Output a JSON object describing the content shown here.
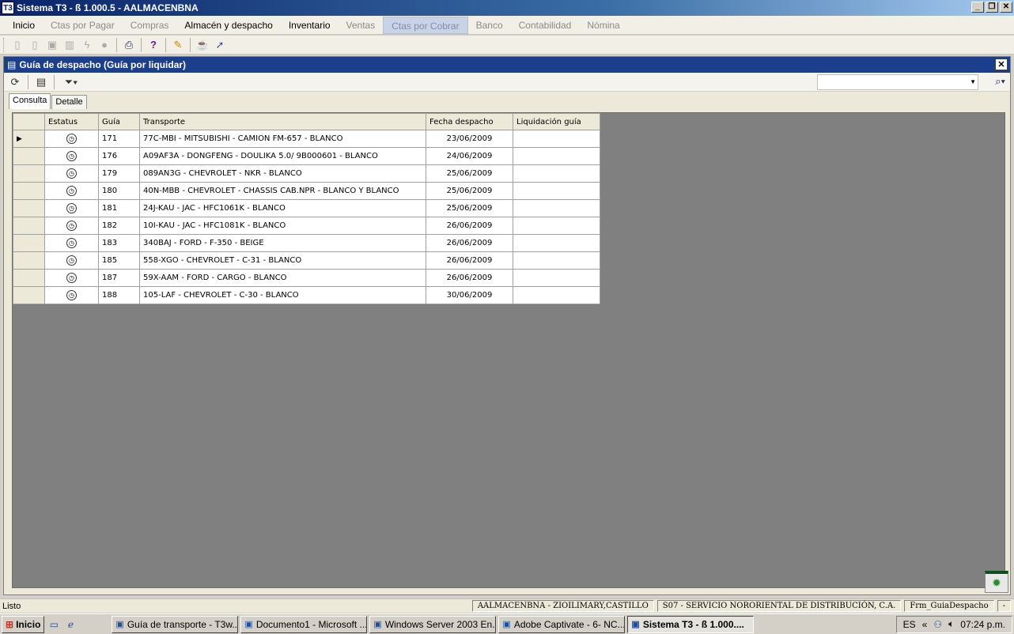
{
  "window": {
    "title": "Sistema T3 - ß 1.000.5 - AALMACENBNA",
    "icon_label": "T3",
    "minimize": "_",
    "maximize": "❐",
    "close": "✕"
  },
  "menu": [
    {
      "label": "Inicio",
      "state": "normal"
    },
    {
      "label": "Ctas por Pagar",
      "state": "disabled"
    },
    {
      "label": "Compras",
      "state": "disabled"
    },
    {
      "label": "Almacén y despacho",
      "state": "normal"
    },
    {
      "label": "Inventario",
      "state": "normal"
    },
    {
      "label": "Ventas",
      "state": "disabled"
    },
    {
      "label": "Ctas por Cobrar",
      "state": "active"
    },
    {
      "label": "Banco",
      "state": "disabled"
    },
    {
      "label": "Contabilidad",
      "state": "disabled"
    },
    {
      "label": "Nómina",
      "state": "disabled"
    }
  ],
  "child": {
    "title": "Guía de despacho (Guía por liquidar)",
    "close": "✕",
    "tabs": [
      "Consulta",
      "Detalle"
    ]
  },
  "grid": {
    "columns": [
      "",
      "Estatus",
      "Guía",
      "Transporte",
      "Fecha despacho",
      "Liquidación guía"
    ],
    "rows": [
      {
        "guia": "171",
        "transporte": "77C-MBI - MITSUBISHI - CAMION FM-657 - BLANCO",
        "fecha": "23/06/2009",
        "liquidacion": ""
      },
      {
        "guia": "176",
        "transporte": "A09AF3A - DONGFENG - DOULIKA 5.0/ 9B000601 - BLANCO",
        "fecha": "24/06/2009",
        "liquidacion": ""
      },
      {
        "guia": "179",
        "transporte": "089AN3G - CHEVROLET - NKR - BLANCO",
        "fecha": "25/06/2009",
        "liquidacion": ""
      },
      {
        "guia": "180",
        "transporte": "40N-MBB - CHEVROLET - CHASSIS CAB.NPR - BLANCO Y BLANCO",
        "fecha": "25/06/2009",
        "liquidacion": ""
      },
      {
        "guia": "181",
        "transporte": "24J-KAU - JAC - HFC1061K - BLANCO",
        "fecha": "25/06/2009",
        "liquidacion": ""
      },
      {
        "guia": "182",
        "transporte": "10I-KAU - JAC - HFC1081K - BLANCO",
        "fecha": "26/06/2009",
        "liquidacion": ""
      },
      {
        "guia": "183",
        "transporte": "340BAJ - FORD - F-350 - BEIGE",
        "fecha": "26/06/2009",
        "liquidacion": ""
      },
      {
        "guia": "185",
        "transporte": "558-XGO - CHEVROLET - C-31 - BLANCO",
        "fecha": "26/06/2009",
        "liquidacion": ""
      },
      {
        "guia": "187",
        "transporte": "59X-AAM - FORD - CARGO - BLANCO",
        "fecha": "26/06/2009",
        "liquidacion": ""
      },
      {
        "guia": "188",
        "transporte": "105-LAF - CHEVROLET - C-30 - BLANCO",
        "fecha": "30/06/2009",
        "liquidacion": ""
      }
    ]
  },
  "statusbar": {
    "left": "Listo",
    "user": "AALMACENBNA - ZIOILIMARY,CASTILLO",
    "company": "S07 - SERVICIO NORORIENTAL DE DISTRIBUCIÓN, C.A.",
    "form": "Frm_GuiaDespacho",
    "extra": "-"
  },
  "taskbar": {
    "start": "Inicio",
    "tasks": [
      {
        "label": "Guía de transporte - T3w...",
        "active": false
      },
      {
        "label": "Documento1 - Microsoft ...",
        "active": false
      },
      {
        "label": "Windows Server 2003 En...",
        "active": false
      },
      {
        "label": "Adobe Captivate - 6- NC...",
        "active": false
      },
      {
        "label": "Sistema T3 - ß 1.000....",
        "active": true
      }
    ],
    "lang": "ES",
    "tray_arrow": "«",
    "clock": "07:24 p.m."
  }
}
